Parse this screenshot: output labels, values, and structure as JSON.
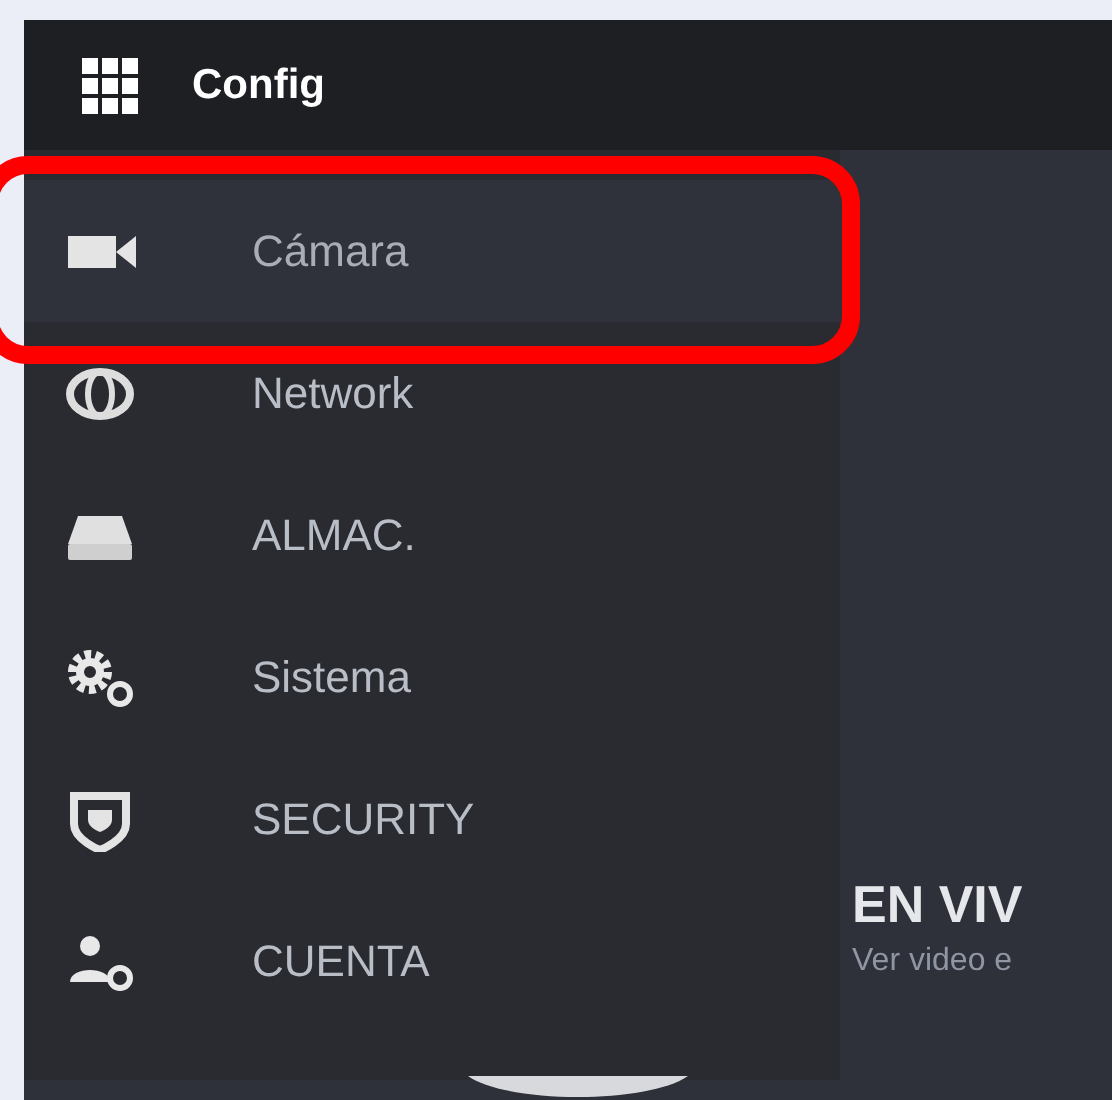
{
  "header": {
    "title": "Config"
  },
  "menu": [
    {
      "kind": "camera",
      "label": "Cámara",
      "selected": true,
      "annotated": true
    },
    {
      "kind": "network",
      "label": "Network",
      "selected": false,
      "annotated": false
    },
    {
      "kind": "storage",
      "label": "ALMAC.",
      "selected": false,
      "annotated": false
    },
    {
      "kind": "system",
      "label": "Sistema",
      "selected": false,
      "annotated": false
    },
    {
      "kind": "security",
      "label": "SECURITY",
      "selected": false,
      "annotated": false
    },
    {
      "kind": "account",
      "label": "CUENTA",
      "selected": false,
      "annotated": false
    }
  ],
  "live": {
    "title": "EN VIV",
    "subtitle": "Ver video e"
  }
}
